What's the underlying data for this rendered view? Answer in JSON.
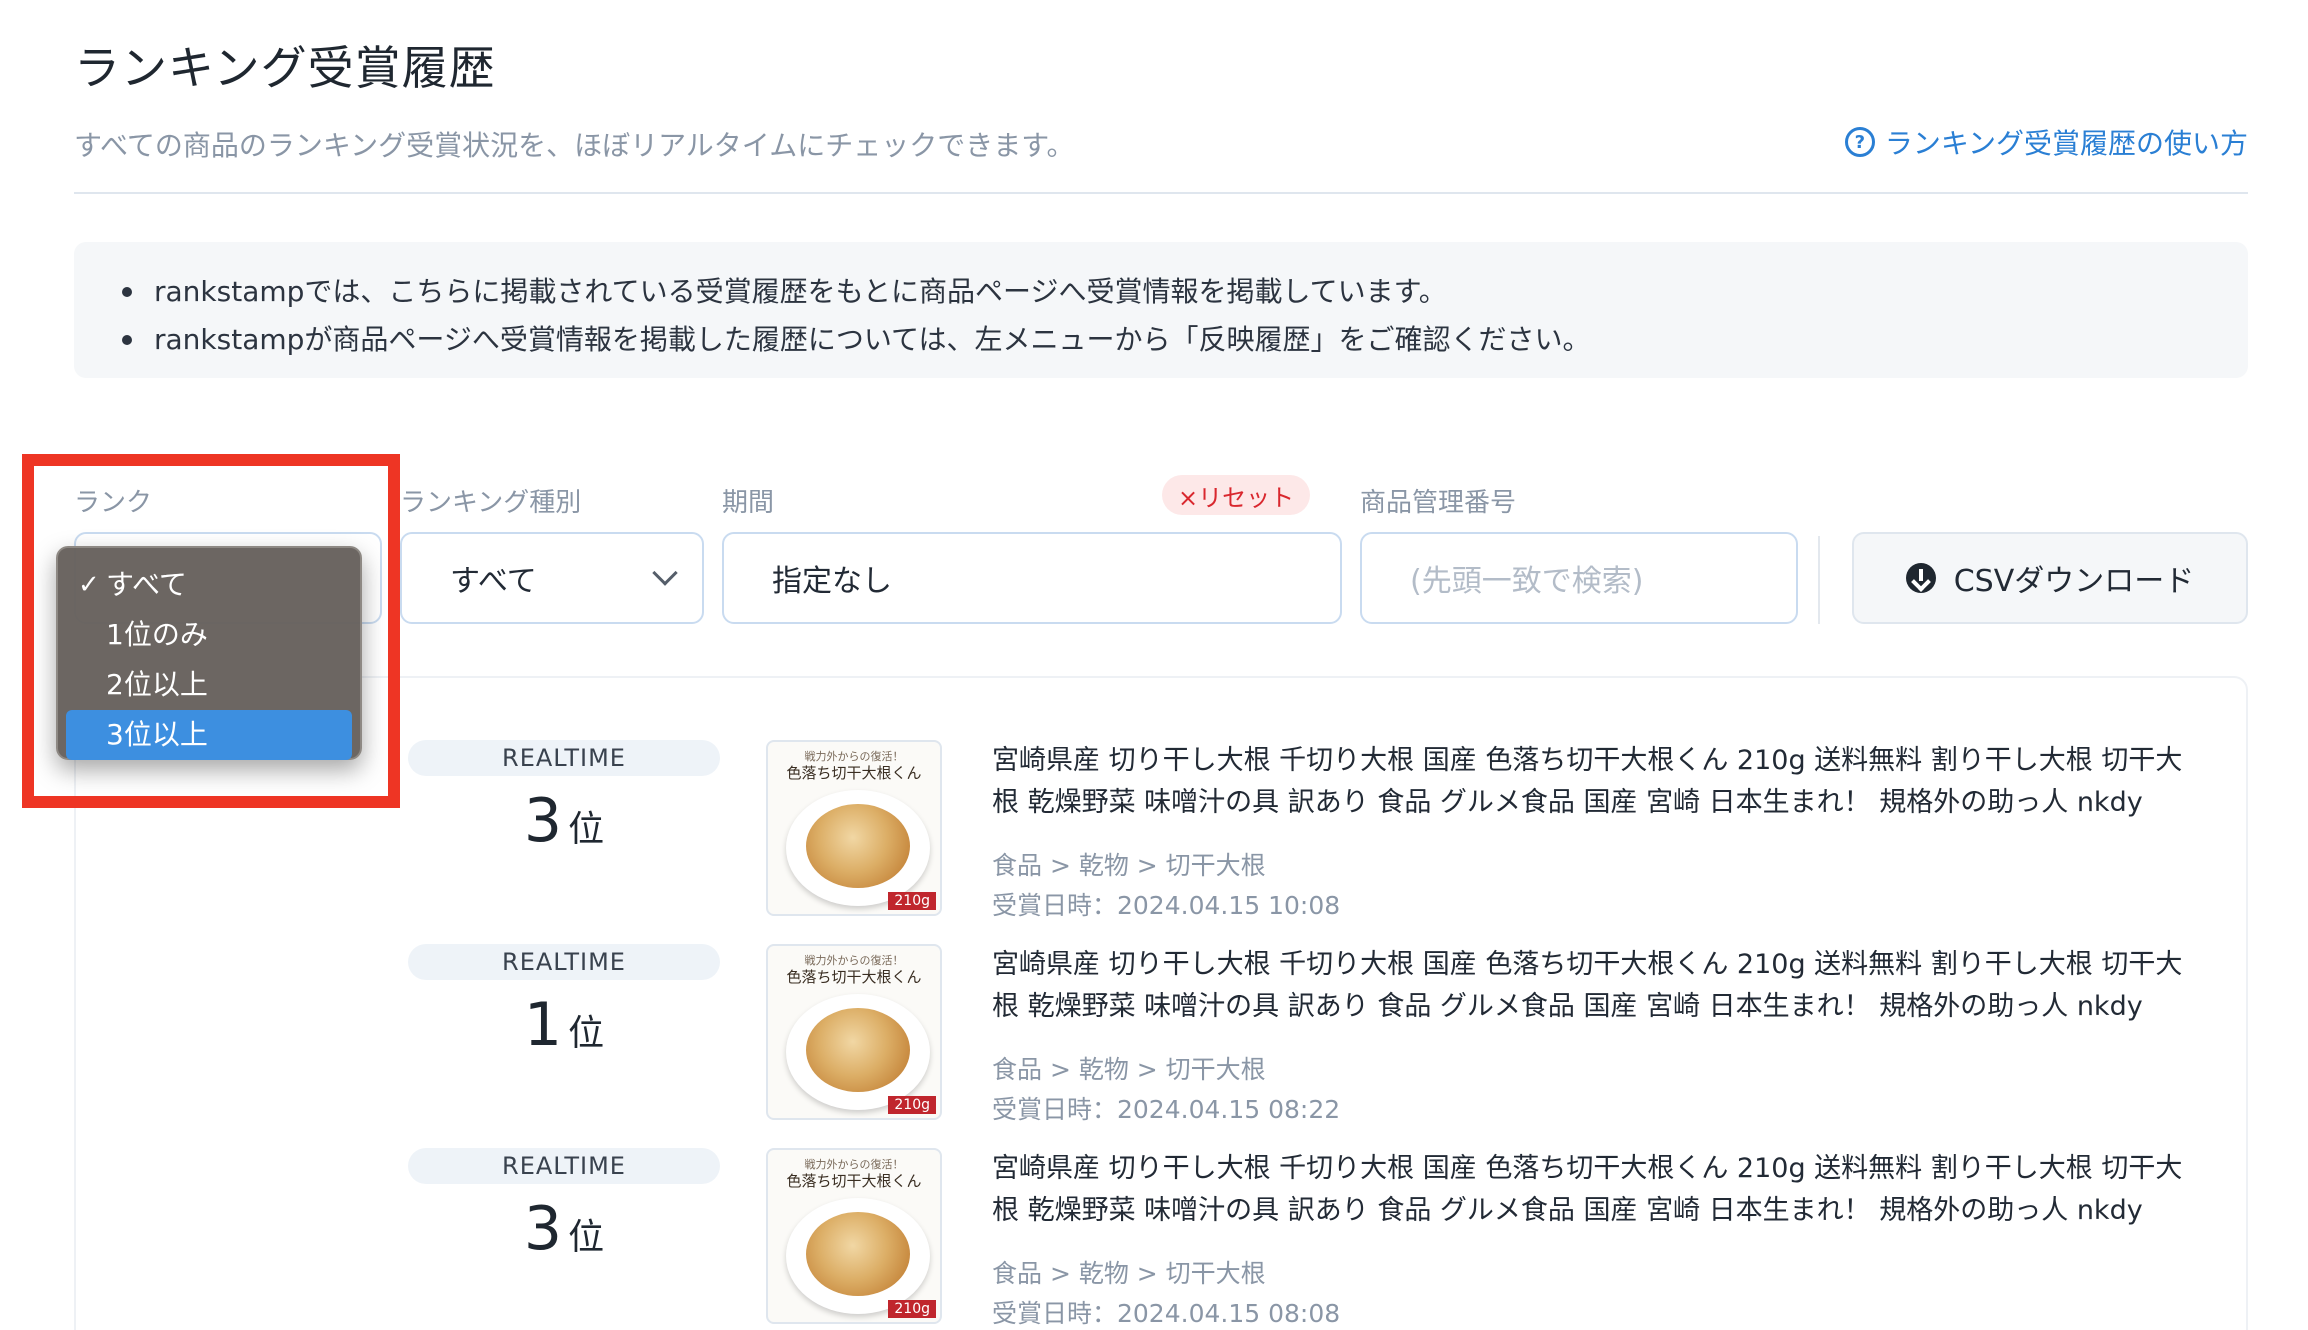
{
  "header": {
    "title": "ランキング受賞履歴",
    "subtitle": "すべての商品のランキング受賞状況を、ほぼリアルタイムにチェックできます。",
    "help_link": "ランキング受賞履歴の使い方"
  },
  "info": {
    "items": [
      "rankstampでは、こちらに掲載されている受賞履歴をもとに商品ページへ受賞情報を掲載しています。",
      "rankstampが商品ページへ受賞情報を掲載した履歴については、左メニューから「反映履歴」をご確認ください。"
    ]
  },
  "filters": {
    "rank_label": "ランク",
    "ranking_type_label": "ランキング種別",
    "ranking_type_value": "すべて",
    "period_label": "期間",
    "period_value": "指定なし",
    "reset_label": "×リセット",
    "product_id_label": "商品管理番号",
    "product_id_placeholder": "(先頭一致で検索)",
    "csv_label": "CSVダウンロード"
  },
  "rank_dropdown": {
    "check": "✓",
    "options": [
      "すべて",
      "1位のみ",
      "2位以上",
      "3位以上"
    ],
    "checked_option": "すべて",
    "highlighted_option": "3位以上"
  },
  "results": [
    {
      "type": "REALTIME",
      "rank": "3",
      "rank_suffix": "位",
      "image_caption_top": "戦力外からの復活！",
      "image_caption": "色落ち切干大根くん",
      "image_badge": "210g",
      "title": "宮崎県産 切り干し大根 千切り大根 国産 色落ち切干大根くん 210g 送料無料 割り干し大根 切干大根 乾燥野菜 味噌汁の具 訳あり 食品 グルメ食品 国産 宮崎 日本生まれ！ 規格外の助っ人 nkdy",
      "category": "食品 > 乾物 > 切干大根",
      "award_date": "受賞日時：2024.04.15 10:08"
    },
    {
      "type": "REALTIME",
      "rank": "1",
      "rank_suffix": "位",
      "image_caption_top": "戦力外からの復活！",
      "image_caption": "色落ち切干大根くん",
      "image_badge": "210g",
      "title": "宮崎県産 切り干し大根 千切り大根 国産 色落ち切干大根くん 210g 送料無料 割り干し大根 切干大根 乾燥野菜 味噌汁の具 訳あり 食品 グルメ食品 国産 宮崎 日本生まれ！ 規格外の助っ人 nkdy",
      "category": "食品 > 乾物 > 切干大根",
      "award_date": "受賞日時：2024.04.15 08:22"
    },
    {
      "type": "REALTIME",
      "rank": "3",
      "rank_suffix": "位",
      "image_caption_top": "戦力外からの復活！",
      "image_caption": "色落ち切干大根くん",
      "image_badge": "210g",
      "title": "宮崎県産 切り干し大根 千切り大根 国産 色落ち切干大根くん 210g 送料無料 割り干し大根 切干大根 乾燥野菜 味噌汁の具 訳あり 食品 グルメ食品 国産 宮崎 日本生まれ！ 規格外の助っ人 nkdy",
      "category": "食品 > 乾物 > 切干大根",
      "award_date": "受賞日時：2024.04.15 08:08"
    }
  ]
}
